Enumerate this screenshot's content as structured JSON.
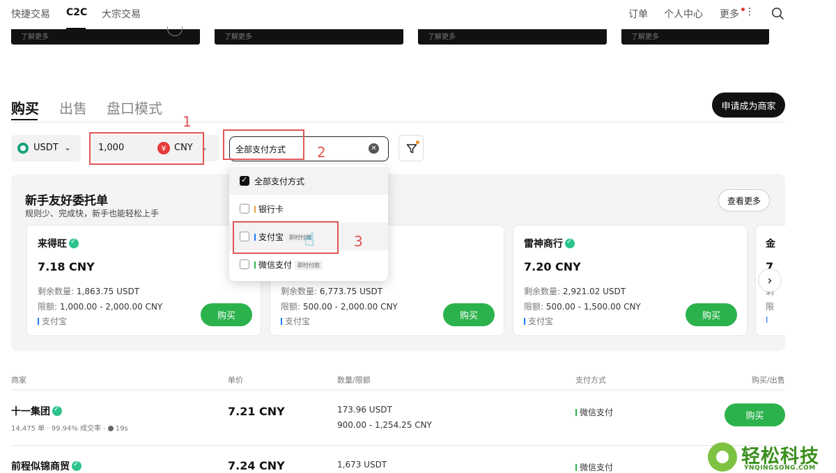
{
  "topnav": {
    "items": [
      "快捷交易",
      "C2C",
      "大宗交易"
    ],
    "right": [
      "订单",
      "个人中心",
      "更多"
    ]
  },
  "banners": [
    "了解更多",
    "了解更多",
    "了解更多",
    "了解更多"
  ],
  "tabs": [
    "购买",
    "出售",
    "盘口模式"
  ],
  "merchant_button": "申请成为商家",
  "filters": {
    "coin": "USDT",
    "amount": "1,000",
    "currency_symbol": "¥",
    "currency": "CNY",
    "payment_method": "全部支付方式",
    "filter_icon": "filter-icon"
  },
  "annotations": [
    "1",
    "2",
    "3"
  ],
  "dropdown": {
    "options": [
      {
        "label": "全部支付方式",
        "checked": true,
        "tag": ""
      },
      {
        "label": "银行卡",
        "checked": false,
        "tag": "",
        "color": "#e8a045"
      },
      {
        "label": "支付宝",
        "checked": false,
        "tag": "即时付款",
        "color": "#1677ff"
      },
      {
        "label": "微信支付",
        "checked": false,
        "tag": "即时付款",
        "color": "#2bb24c"
      }
    ]
  },
  "newbie": {
    "title": "新手友好委托单",
    "subtitle": "规则少、完成快，新手也能轻松上手",
    "see_more": "查看更多",
    "cards": [
      {
        "name": "来得旺",
        "price": "7.18 CNY",
        "qty_label": "剩余数量:",
        "qty": "1,863.75 USDT",
        "limit_label": "限额:",
        "limit": "1,000.00 - 2,000.00 CNY",
        "pay": "支付宝",
        "buy": "购买"
      },
      {
        "name": "",
        "price": "",
        "qty_label": "剩余数量:",
        "qty": "6,773.75 USDT",
        "limit_label": "限额:",
        "limit": "500.00 - 2,000.00 CNY",
        "pay": "支付宝",
        "buy": "购买"
      },
      {
        "name": "雷神商行",
        "price": "7.20 CNY",
        "qty_label": "剩余数量:",
        "qty": "2,921.02 USDT",
        "limit_label": "限额:",
        "limit": "500.00 - 1,500.00 CNY",
        "pay": "支付宝",
        "buy": "购买"
      }
    ],
    "partial_card_chars": [
      "金",
      "7",
      "剩",
      "限",
      "I"
    ]
  },
  "table": {
    "headers": [
      "商家",
      "单价",
      "数量/限额",
      "支付方式",
      "购买/出售"
    ],
    "rows": [
      {
        "name": "十一集团",
        "orders": "14,475 单",
        "rate": "99.94% 成交率",
        "time": "19s",
        "price": "7.21 CNY",
        "qty": "173.96 USDT",
        "limit": "900.00 - 1,254.25 CNY",
        "pay": "微信支付",
        "buy": "购买"
      },
      {
        "name": "前程似锦商贸",
        "price": "7.24 CNY",
        "qty": "1,673 USDT",
        "pay": "微信支付"
      }
    ]
  },
  "watermark": {
    "title": "轻松科技",
    "sub": "YNQINGSONG.COM"
  }
}
